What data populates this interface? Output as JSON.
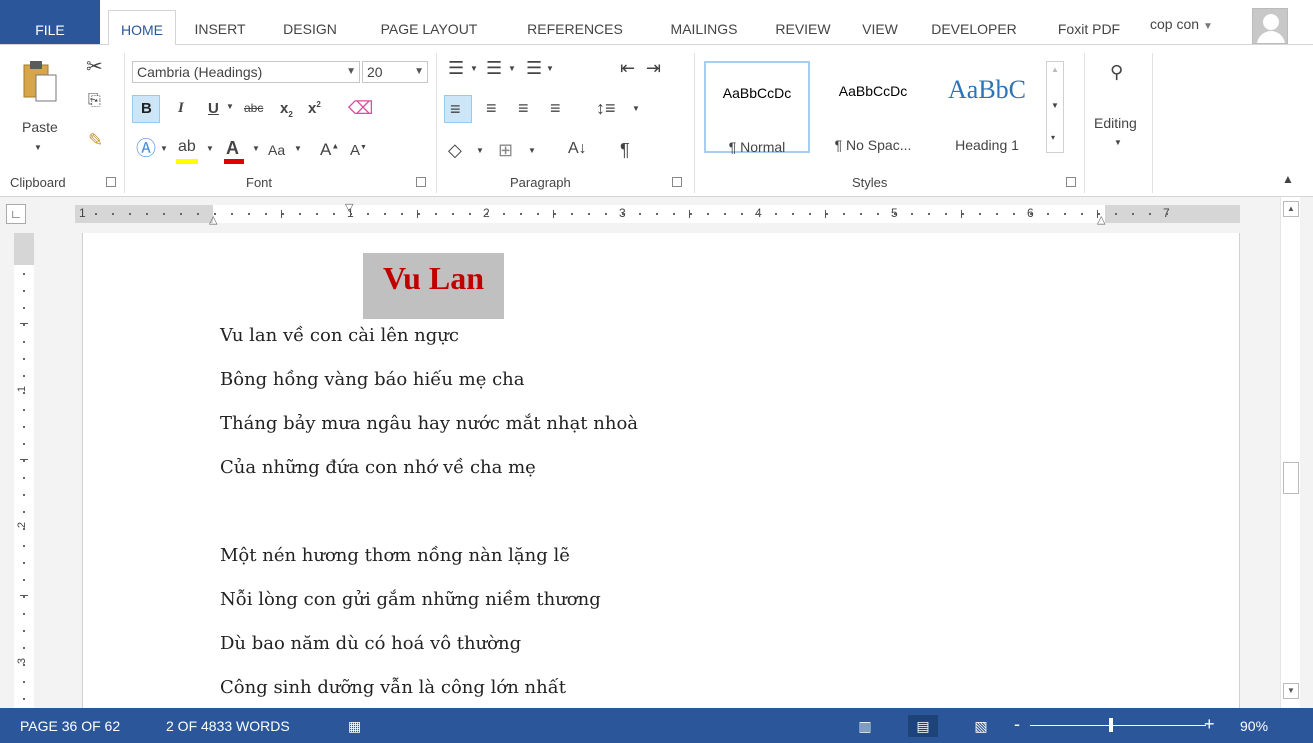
{
  "tabs": [
    "FILE",
    "HOME",
    "INSERT",
    "DESIGN",
    "PAGE LAYOUT",
    "REFERENCES",
    "MAILINGS",
    "REVIEW",
    "VIEW",
    "DEVELOPER",
    "Foxit PDF"
  ],
  "user": "cop con",
  "ribbon": {
    "clipboard": {
      "paste_label": "Paste",
      "group_label": "Clipboard"
    },
    "font": {
      "font_name": "Cambria (Headings)",
      "font_size": "20",
      "group_label": "Font",
      "bold": "B",
      "italic": "I",
      "underline": "U",
      "strike": "abc",
      "subscript": "x",
      "superscript": "x",
      "change_case": "Aa",
      "grow": "A",
      "shrink": "A"
    },
    "paragraph": {
      "group_label": "Paragraph",
      "pilcrow": "¶"
    },
    "styles": {
      "group_label": "Styles",
      "items": [
        {
          "sample": "AaBbCcDc",
          "name": "¶ Normal"
        },
        {
          "sample": "AaBbCcDc",
          "name": "¶ No Spac..."
        },
        {
          "sample": "AaBbC",
          "name": "Heading 1"
        }
      ]
    },
    "editing": {
      "label": "Editing"
    }
  },
  "ruler": {
    "numbers": [
      "1",
      "1",
      "2",
      "3",
      "4",
      "5",
      "6",
      "7"
    ],
    "vnumbers": [
      "1",
      "2",
      "3"
    ]
  },
  "document": {
    "title": "Vu Lan",
    "lines": [
      "Vu lan về con cài lên ngực",
      "Bông hồng vàng báo hiếu mẹ cha",
      "Tháng bảy mưa ngâu hay nước mắt nhạt nhoà",
      "Của những đứa con nhớ về cha mẹ",
      "",
      "Một nén hương thơm nồng nàn lặng lẽ",
      "Nỗi lòng con gửi gắm những niềm thương",
      "Dù bao năm dù có hoá vô thường",
      "Công sinh dưỡng vẫn là công lớn nhất"
    ]
  },
  "status": {
    "page": "PAGE 36 OF 62",
    "words": "2 OF 4833 WORDS",
    "zoom": "90%",
    "zoom_minus": "-",
    "zoom_plus": "+"
  },
  "colors": {
    "accent": "#2b579a",
    "title_red": "#c00000",
    "title_highlight": "#c0c0c0"
  }
}
